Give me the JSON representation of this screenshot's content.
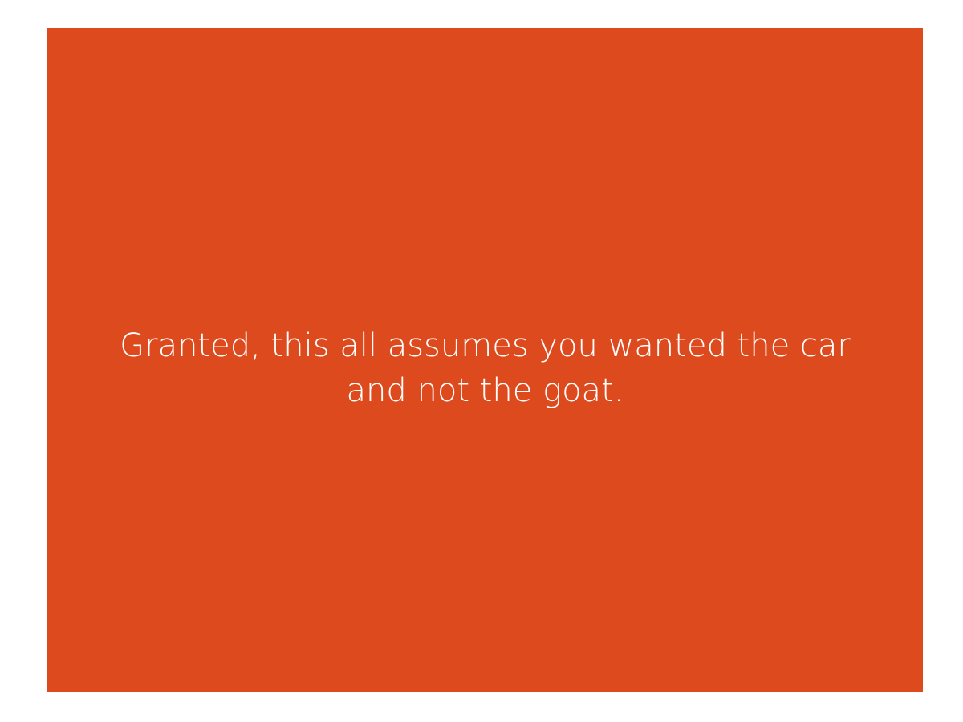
{
  "slide": {
    "background_color": "#dd4a1e",
    "text_color": "#ffffff",
    "text_line_1": "Granted, this all assumes you wanted the car",
    "text_line_2": "and not the goat."
  }
}
